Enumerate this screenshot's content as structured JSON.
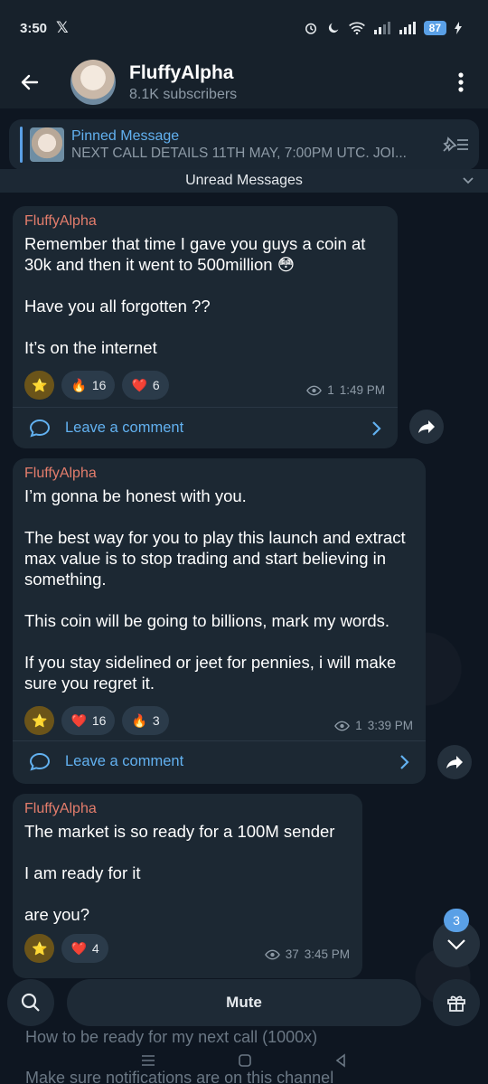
{
  "status": {
    "time": "3:50",
    "x_logo": "𝕏",
    "battery": "87"
  },
  "header": {
    "channel_name": "FluffyAlpha",
    "subscribers": "8.1K subscribers"
  },
  "pinned": {
    "title": "Pinned Message",
    "preview": "NEXT CALL DETAILS  11TH MAY, 7:00PM UTC.  JOI..."
  },
  "unread_label": "Unread Messages",
  "messages": [
    {
      "author": "FluffyAlpha",
      "text": "Remember that time I gave you guys a coin at 30k and then it went to 500million 😳\n\nHave you all forgotten ??\n\nIt’s on the internet",
      "reactions": [
        {
          "emoji": "⭐",
          "count": ""
        },
        {
          "emoji": "🔥",
          "count": "16"
        },
        {
          "emoji": "❤️",
          "count": "6"
        }
      ],
      "views": "1",
      "time": "1:49 PM",
      "comment_label": "Leave a comment"
    },
    {
      "author": "FluffyAlpha",
      "text": "I’m gonna be honest with you.\n\nThe best way for you to play this launch and extract max value is to stop trading and start believing in something.\n\nThis coin will be going to billions, mark my words.\n\nIf you stay sidelined or jeet for pennies, i will make sure you regret it.",
      "reactions": [
        {
          "emoji": "⭐",
          "count": ""
        },
        {
          "emoji": "❤️",
          "count": "16"
        },
        {
          "emoji": "🔥",
          "count": "3"
        }
      ],
      "views": "1",
      "time": "3:39 PM",
      "comment_label": "Leave a comment"
    },
    {
      "author": "FluffyAlpha",
      "text": "The market is so ready for a 100M sender\n\nI am ready for it\n\nare you?",
      "reactions": [
        {
          "emoji": "⭐",
          "count": ""
        },
        {
          "emoji": "❤️",
          "count": "4"
        }
      ],
      "views": "37",
      "time": "3:45 PM"
    }
  ],
  "scroll_badge": "3",
  "bottom": {
    "mute_label": "Mute",
    "ghost_line_1": "How to be ready for my next call (1000x)",
    "ghost_line_2": "Make sure notifications are on this channel"
  },
  "colors": {
    "accent": "#62b1f0",
    "author": "#e47d6c",
    "bubble": "#1c2833",
    "background": "#0e1621"
  }
}
